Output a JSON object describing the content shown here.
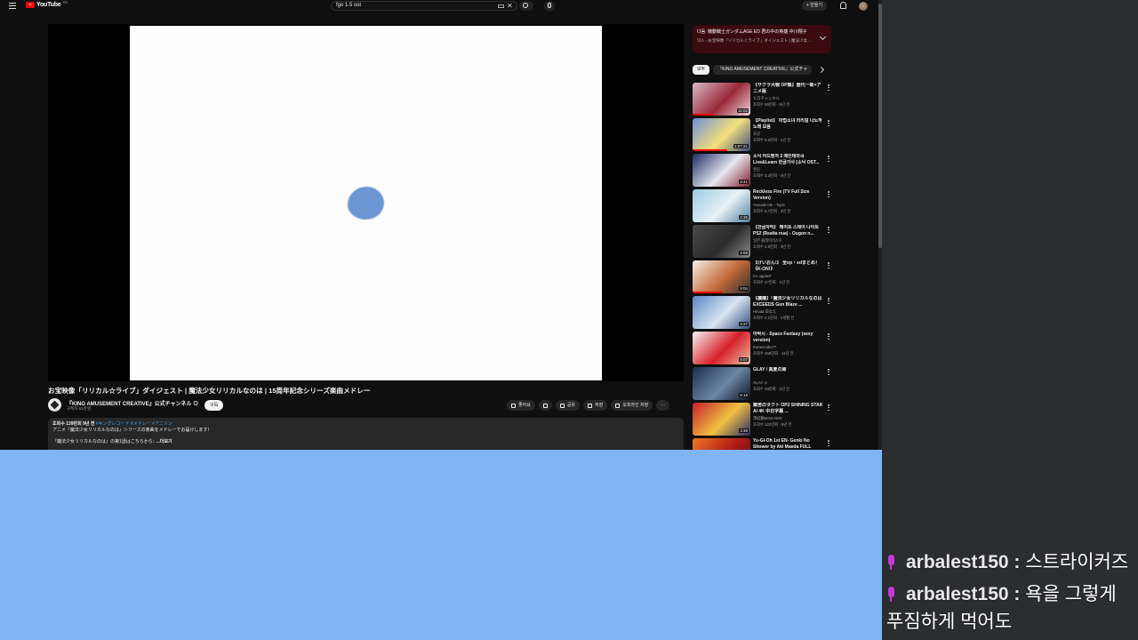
{
  "youtube": {
    "logo_text": "YouTube",
    "logo_country": "KR",
    "search_query": "fgo 1.5 ost",
    "create_label": "+ 만들기",
    "video": {
      "title": "お宝映像「リリカル☆ライブ」ダイジェスト | 魔法少女リリカルなのは | 15周年記念シリーズ楽曲メドレー",
      "channel": "『KING AMUSEMENT CREATIVE』公式チャンネル ⊙",
      "subscribers": "구독자 61만명",
      "subscribe_label": "구독",
      "actions": [
        "좋아요",
        "",
        "공유",
        "저장",
        "오프라인 저장"
      ],
      "description": {
        "meta": "조회수 139만회  9년 전",
        "tags": "#キングレコード #メドレー #アニソン",
        "line1": "アニメ『魔法少女リリカルなのは』シリーズの楽曲をメドレーでお届けします！",
        "line2": "『魔法少女リリカルなのは』の第1話はこちらから↓",
        "more": "...더보기"
      }
    },
    "live_chat": {
      "line1": "다음: 機動戦士ガンダムAGE ED 君の中の英雄 中川翔子",
      "line2": "믹스 - お宝映像「リリカル☆ライブ」ダイジェスト | 魔法少女..."
    },
    "chips": [
      "모두",
      "『KING AMUSEMENT CREATIVE』公式チャ"
    ],
    "recommendations": [
      {
        "title": "【サクラ大戦 OP集】歴代一新+アニメ版",
        "channel": "ヒロチャンネル",
        "meta": "조회수 58만회 · 6년 전",
        "duration": "11:02",
        "palette": [
          "#d8b8c8",
          "#9a2a3a",
          "#f0d6dc"
        ],
        "progress": 0.35
      },
      {
        "title": "【Playlist】 마법소녀 리리컬 나노하 노래 모음",
        "channel": "호냥",
        "meta": "조회수 9.6만회 · 1년 전",
        "duration": "1:07:21",
        "palette": [
          "#6c8fd6",
          "#f5e07a",
          "#3b4c80"
        ],
        "progress": 0.6
      },
      {
        "title": "소닉 어드벤처 2 메인테마곡 Live&Learn 한글가사 [소닉 OST...",
        "channel": "엔진",
        "meta": "조회수 3.3만회 · 4년 전",
        "duration": "4:41",
        "palette": [
          "#1d2b66",
          "#e6e6ee",
          "#7f1d2d"
        ],
        "progress": 0.0
      },
      {
        "title": "Reckless Fire (TV Full Size Version)",
        "channel": "Yasuaki Ide - Topic",
        "meta": "조회수 5.7만회 · 4년 전",
        "duration": "4:35",
        "palette": [
          "#9ccbe0",
          "#e8f0f6",
          "#4f7fa0"
        ],
        "progress": 0.0
      },
      {
        "title": "【한글자막】 페이트 스테이 나이트 PS2 (Realta nua) - Ougon n...",
        "channel": "일본 플레이리스트",
        "meta": "조회수 2.8만회 · 3년 전",
        "duration": "4:59",
        "palette": [
          "#4a4a4a",
          "#2a2a2a",
          "#8a8a8a"
        ],
        "progress": 0.0
      },
      {
        "title": "【けいおん!】 全op・edまとめ！《K-ON!》",
        "channel": "Kn ugpanF",
        "meta": "조회수 27만회 · 1년 전",
        "duration": "9:04",
        "palette": [
          "#f4efe6",
          "#c56b3a",
          "#2c2c2c"
        ],
        "progress": 0.5
      },
      {
        "title": "【讀爆】「魔法少女リリカルなのは EXCEEDS Gun Blaze ...",
        "channel": "Hinata 日なた",
        "meta": "조회수 2.1만회 · 1개월 전",
        "duration": "3:27",
        "palette": [
          "#5a86c4",
          "#d8e4f2",
          "#2f4a74"
        ],
        "progress": 0.0
      },
      {
        "title": "아박시 - Space Fantasy (sexy version)",
        "channel": "Kaneezuku77",
        "meta": "조회수 260만회 · 11년 전",
        "duration": "5:07",
        "palette": [
          "#f4f4f4",
          "#d8202a",
          "#e6c0a8"
        ],
        "progress": 0.0
      },
      {
        "title": "GLAY / 真夏の扉",
        "channel": "GLAY ⊙",
        "meta": "조회수 29만회 · 2년 전",
        "duration": "5:18",
        "palette": [
          "#1a2e4a",
          "#6d86a6",
          "#0c1624"
        ],
        "progress": 0.0
      },
      {
        "title": "鎖苦のタクト OP2 SHINING STAR AI 4K 中日字幕 ...",
        "channel": "澪虹動MAD AMV",
        "meta": "조회수 122만회 · 8년 전",
        "duration": "3:39",
        "palette": [
          "#c4202a",
          "#f0c040",
          "#2a2a6a"
        ],
        "progress": 0.0
      },
      {
        "title": "Yu-Gi-Oh 1st EN- Genki No Shower by Aki Maeda FULL",
        "channel": "",
        "meta": "",
        "duration": "",
        "palette": [
          "#f07a20",
          "#b01818",
          "#3a1a0a"
        ],
        "progress": 0.0
      }
    ]
  },
  "chat": {
    "messages": [
      {
        "user": "arbalest150",
        "sep": " : ",
        "text": "스트라이커즈",
        "text2": ""
      },
      {
        "user": "arbalest150",
        "sep": " : ",
        "text": "욕을 그렇게",
        "text2": "푸짐하게 먹어도"
      }
    ]
  },
  "colors": {
    "yt_bg": "#0f0f0f",
    "blue_panel": "#7fb4f5",
    "chat_bg": "#2b2d31",
    "mic_accent": "#c23bd8",
    "yt_red": "#ff0000"
  }
}
